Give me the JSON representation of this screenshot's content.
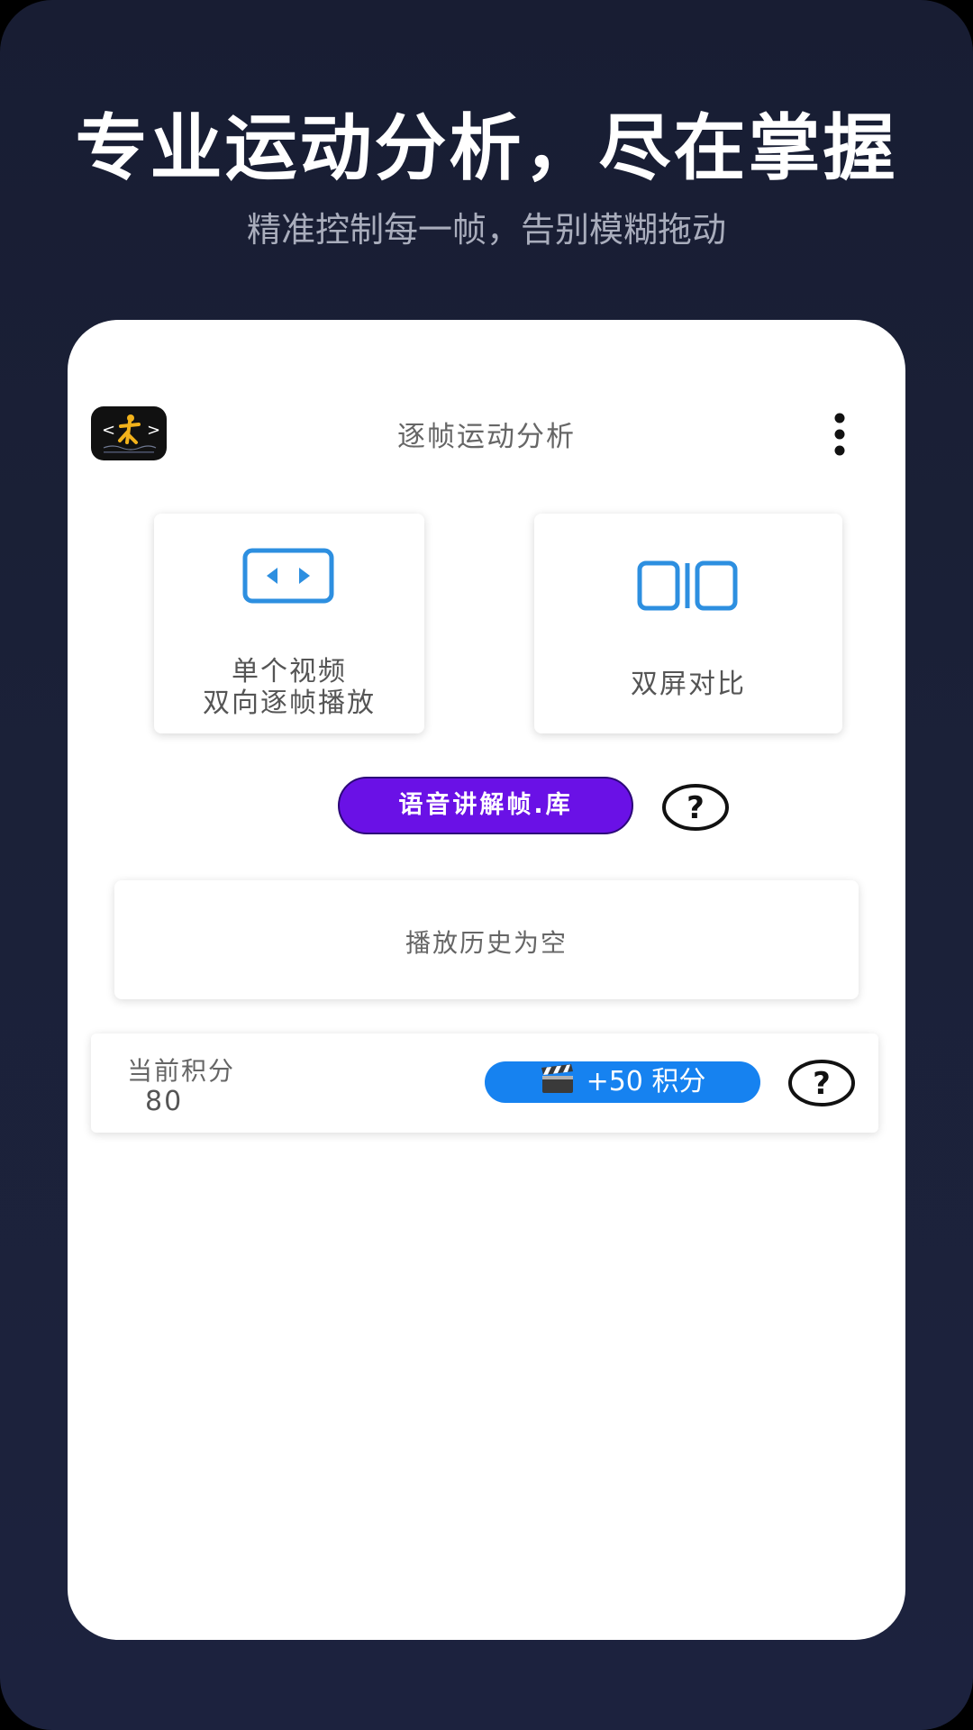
{
  "promo": {
    "headline": "专业运动分析，尽在掌握",
    "subline": "精准控制每一帧，告别模糊拖动"
  },
  "app": {
    "title": "逐帧运动分析",
    "logo_icon": "app-logo-icon",
    "menu_icon": "more-vert-icon"
  },
  "modes": [
    {
      "label_line1": "单个视频",
      "label_line2": "双向逐帧播放",
      "icon": "single-video-frame-icon"
    },
    {
      "label_line1": "双屏对比",
      "icon": "dual-screen-icon"
    }
  ],
  "voice_button": {
    "label": "语音讲解帧.库"
  },
  "history": {
    "empty_text": "播放历史为空"
  },
  "points": {
    "label": "当前积分",
    "value": "80",
    "earn_button": "+50 积分",
    "earn_icon": "clapperboard-icon"
  },
  "colors": {
    "background": "#1b2138",
    "accent_purple": "#6a11e6",
    "accent_blue": "#1682f0",
    "icon_blue": "#2d8fe0",
    "logo_yellow": "#f2b21b"
  }
}
